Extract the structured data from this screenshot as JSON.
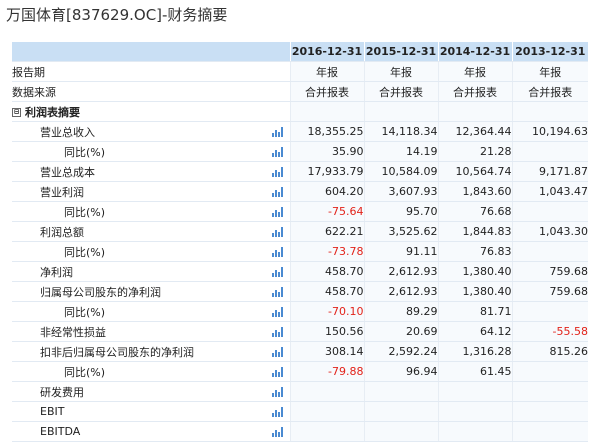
{
  "page_title": "万国体育[837629.OC]-财务摘要",
  "columns": [
    "2016-12-31",
    "2015-12-31",
    "2014-12-31",
    "2013-12-31"
  ],
  "rows": [
    {
      "label": "报告期",
      "indent": 0,
      "kind": "meta",
      "chart": false,
      "values": [
        "年报",
        "年报",
        "年报",
        "年报"
      ]
    },
    {
      "label": "数据来源",
      "indent": 0,
      "kind": "meta",
      "chart": false,
      "values": [
        "合并报表",
        "合并报表",
        "合并报表",
        "合并报表"
      ]
    },
    {
      "label": "利润表摘要",
      "indent": 0,
      "kind": "section",
      "chart": false,
      "toggle": "⊟",
      "values": [
        "",
        "",
        "",
        ""
      ]
    },
    {
      "label": "营业总收入",
      "indent": 1,
      "kind": "data",
      "chart": true,
      "values": [
        "18,355.25",
        "14,118.34",
        "12,364.44",
        "10,194.63"
      ]
    },
    {
      "label": "同比(%)",
      "indent": 2,
      "kind": "data",
      "chart": true,
      "values": [
        "35.90",
        "14.19",
        "21.28",
        ""
      ]
    },
    {
      "label": "营业总成本",
      "indent": 1,
      "kind": "data",
      "chart": true,
      "values": [
        "17,933.79",
        "10,584.09",
        "10,564.74",
        "9,171.87"
      ]
    },
    {
      "label": "营业利润",
      "indent": 1,
      "kind": "data",
      "chart": true,
      "values": [
        "604.20",
        "3,607.93",
        "1,843.60",
        "1,043.47"
      ]
    },
    {
      "label": "同比(%)",
      "indent": 2,
      "kind": "data",
      "chart": true,
      "values": [
        "-75.64",
        "95.70",
        "76.68",
        ""
      ]
    },
    {
      "label": "利润总额",
      "indent": 1,
      "kind": "data",
      "chart": true,
      "values": [
        "622.21",
        "3,525.62",
        "1,844.83",
        "1,043.30"
      ]
    },
    {
      "label": "同比(%)",
      "indent": 2,
      "kind": "data",
      "chart": true,
      "values": [
        "-73.78",
        "91.11",
        "76.83",
        ""
      ]
    },
    {
      "label": "净利润",
      "indent": 1,
      "kind": "data",
      "chart": true,
      "values": [
        "458.70",
        "2,612.93",
        "1,380.40",
        "759.68"
      ]
    },
    {
      "label": "归属母公司股东的净利润",
      "indent": 1,
      "kind": "data",
      "chart": true,
      "values": [
        "458.70",
        "2,612.93",
        "1,380.40",
        "759.68"
      ]
    },
    {
      "label": "同比(%)",
      "indent": 2,
      "kind": "data",
      "chart": true,
      "values": [
        "-70.10",
        "89.29",
        "81.71",
        ""
      ]
    },
    {
      "label": "非经常性损益",
      "indent": 1,
      "kind": "data",
      "chart": true,
      "values": [
        "150.56",
        "20.69",
        "64.12",
        "-55.58"
      ]
    },
    {
      "label": "扣非后归属母公司股东的净利润",
      "indent": 1,
      "kind": "data",
      "chart": true,
      "values": [
        "308.14",
        "2,592.24",
        "1,316.28",
        "815.26"
      ]
    },
    {
      "label": "同比(%)",
      "indent": 2,
      "kind": "data",
      "chart": true,
      "values": [
        "-79.88",
        "96.94",
        "61.45",
        ""
      ]
    },
    {
      "label": "研发费用",
      "indent": 1,
      "kind": "data",
      "chart": true,
      "values": [
        "",
        "",
        "",
        ""
      ]
    },
    {
      "label": "EBIT",
      "indent": 1,
      "kind": "data",
      "chart": true,
      "values": [
        "",
        "",
        "",
        ""
      ]
    },
    {
      "label": "EBITDA",
      "indent": 1,
      "kind": "data",
      "chart": true,
      "values": [
        "",
        "",
        "",
        ""
      ]
    }
  ],
  "icons": {
    "chart_icon": "bar-chart-icon",
    "toggle_icon": "collapse-icon"
  },
  "colors": {
    "header_bg": "#c9dff4",
    "negative": "#e2231a",
    "chart_icon": "#4a8ad1"
  }
}
